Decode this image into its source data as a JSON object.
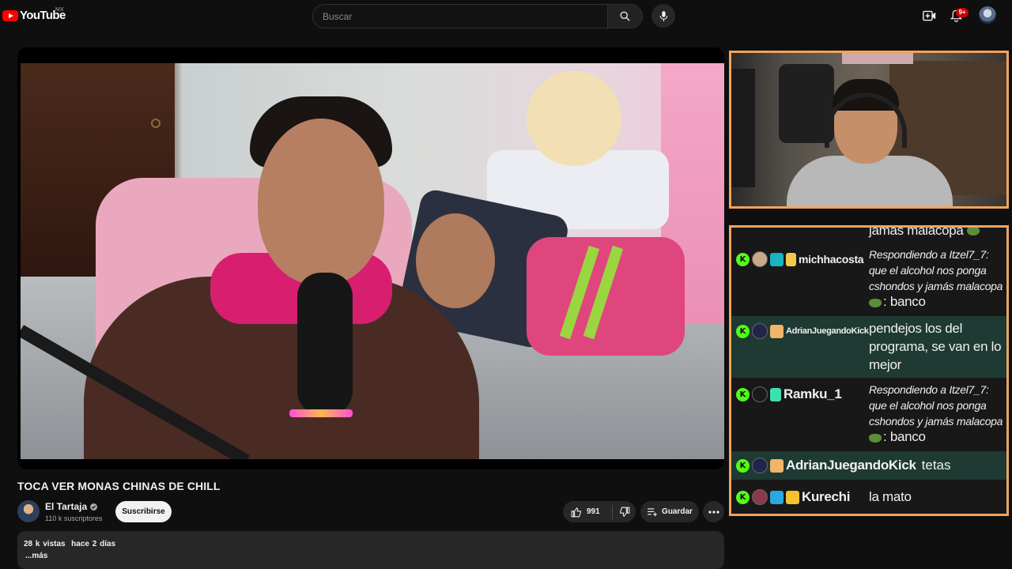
{
  "header": {
    "logo_text": "YouTube",
    "country": "MX",
    "search_placeholder": "Buscar",
    "notification_count": "9+",
    "icons": [
      "search-icon",
      "mic-icon",
      "create-icon",
      "bell-icon",
      "avatar"
    ]
  },
  "video": {
    "title": "TOCA VER MONAS CHINAS DE CHILL",
    "channel_name": "El Tartaja",
    "subscribers": "110 k suscriptores",
    "subscribe_label": "Suscribirse",
    "likes": "991",
    "save_label": "Guardar",
    "views": "28 k vistas",
    "date": "hace 2 días",
    "more_label": "...más"
  },
  "chat": {
    "top_fragment": "jamás malacopa",
    "messages": [
      {
        "user": "michhacosta",
        "text": "Respondiendo a Itzel7_7: que el alcohol nos ponga cshondos y jamás malacopa",
        "text2": ": banco"
      },
      {
        "user": "AdrianJuegandoKick",
        "text": "pendejos los del programa, se van en lo mejor"
      },
      {
        "user": "Ramku_1",
        "text": "Respondiendo a Itzel7_7: que el alcohol nos ponga cshondos y jamás malacopa",
        "text2": ": banco"
      },
      {
        "user": "AdrianJuegandoKick",
        "text": "tetas"
      },
      {
        "user": "Kurechi",
        "text": "la mato"
      }
    ]
  },
  "colors": {
    "accent_border": "#f0a35c",
    "kick_green": "#53fc18",
    "youtube_red": "#ff0000",
    "chat_highlight": "#1e3a32"
  }
}
